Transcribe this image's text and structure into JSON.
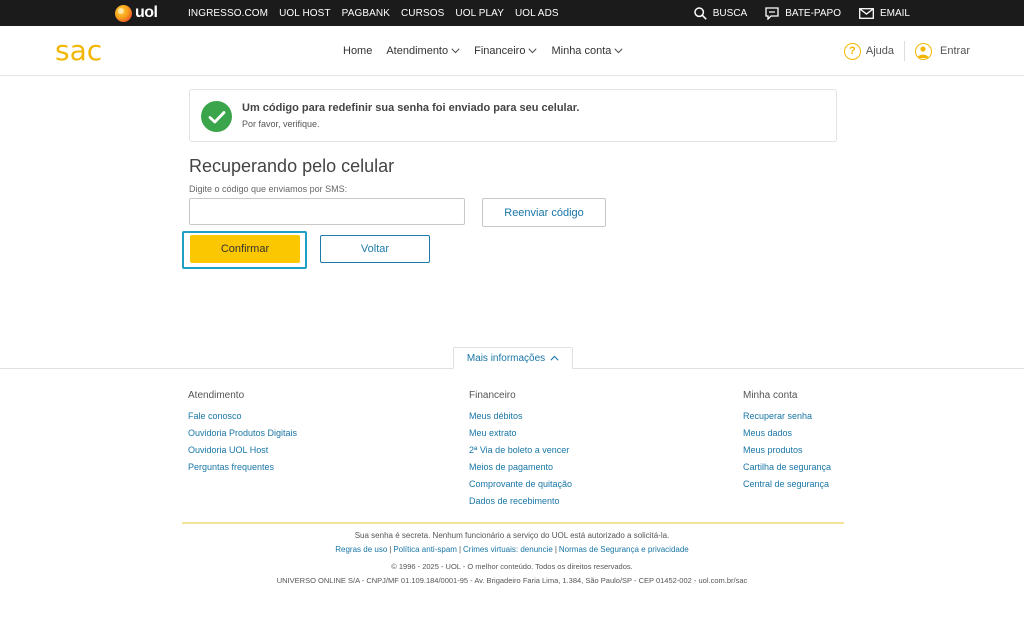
{
  "topbar": {
    "logo_text": "uol",
    "links": [
      "INGRESSO.COM",
      "UOL HOST",
      "PAGBANK",
      "CURSOS",
      "UOL PLAY",
      "UOL ADS"
    ],
    "busca_label": "BUSCA",
    "batepapo_label": "BATE-PAPO",
    "email_label": "EMAIL"
  },
  "header": {
    "brand": "sac",
    "nav": [
      "Home",
      "Atendimento",
      "Financeiro",
      "Minha conta"
    ],
    "help_label": "Ajuda",
    "login_label": "Entrar"
  },
  "alert": {
    "title": "Um código para redefinir sua senha foi enviado para seu celular.",
    "subtitle": "Por favor, verifique."
  },
  "form": {
    "title": "Recuperando pelo celular",
    "label": "Digite o código que enviamos por SMS:",
    "input_value": "",
    "resend_label": "Reenviar código",
    "confirm_label": "Confirmar",
    "back_label": "Voltar"
  },
  "more_info": {
    "label": "Mais informações"
  },
  "footer": {
    "columns": [
      {
        "title": "Atendimento",
        "links": [
          "Fale conosco",
          "Ouvidoria Produtos Digitais",
          "Ouvidoria UOL Host",
          "Perguntas frequentes"
        ]
      },
      {
        "title": "Financeiro",
        "links": [
          "Meus débitos",
          "Meu extrato",
          "2ª Via de boleto a vencer",
          "Meios de pagamento",
          "Comprovante de quitação",
          "Dados de recebimento"
        ]
      },
      {
        "title": "Minha conta",
        "links": [
          "Recuperar senha",
          "Meus dados",
          "Meus produtos",
          "Cartilha de segurança",
          "Central de segurança"
        ]
      }
    ],
    "notice": "Sua senha é secreta. Nenhum funcionário a serviço do UOL está autorizado a solicitá-la.",
    "policy_links": [
      "Regras de uso",
      "Política anti-spam",
      "Crimes virtuais: denuncie",
      "Normas de Segurança e privacidade"
    ],
    "copyright": "© 1996 - 2025 - UOL - O melhor conteúdo. Todos os direitos reservados.",
    "address": "UNIVERSO ONLINE S/A - CNPJ/MF 01.109.184/0001-95 - Av. Brigadeiro Faria Lima, 1.384, São Paulo/SP - CEP 01452-002 - uol.com.br/sac"
  },
  "colors": {
    "brand_yellow": "#f2b705",
    "confirm_yellow": "#fbc700",
    "link_blue": "#1976a6",
    "success_green": "#3aa54a",
    "focus_cyan": "#1ea0c2",
    "topbar_bg": "#1b1b1b"
  },
  "icons": {
    "logo": "uol-logo-icon",
    "search": "search-icon",
    "chat": "chat-icon",
    "email": "envelope-icon",
    "help": "question-icon",
    "user": "user-icon",
    "success": "check-icon",
    "chevron": "chevron-down-icon"
  }
}
